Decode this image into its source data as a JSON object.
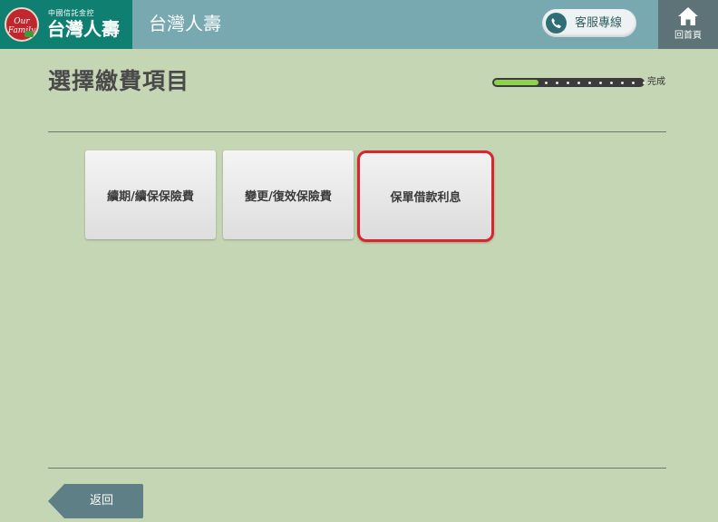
{
  "header": {
    "logo_text": "Our Family",
    "brand_small": "中國信託金控",
    "brand_name": "台灣人壽",
    "title": "台灣人壽",
    "service_label": "客服專線",
    "home_label": "回首頁"
  },
  "page": {
    "title": "選擇繳費項目",
    "progress_label": "完成",
    "progress_fraction": 0.3
  },
  "options": [
    {
      "label": "續期/續保保險費",
      "selected": false
    },
    {
      "label": "變更/復效保險費",
      "selected": false
    },
    {
      "label": "保單借款利息",
      "selected": true
    }
  ],
  "footer": {
    "back_label": "返回"
  },
  "colors": {
    "background": "#c5d6b4",
    "header": "#78a9b0",
    "brand": "#0f7f71",
    "home": "#5d7377",
    "selected_border": "#d9262c",
    "progress_fill": "#8fd14f"
  }
}
